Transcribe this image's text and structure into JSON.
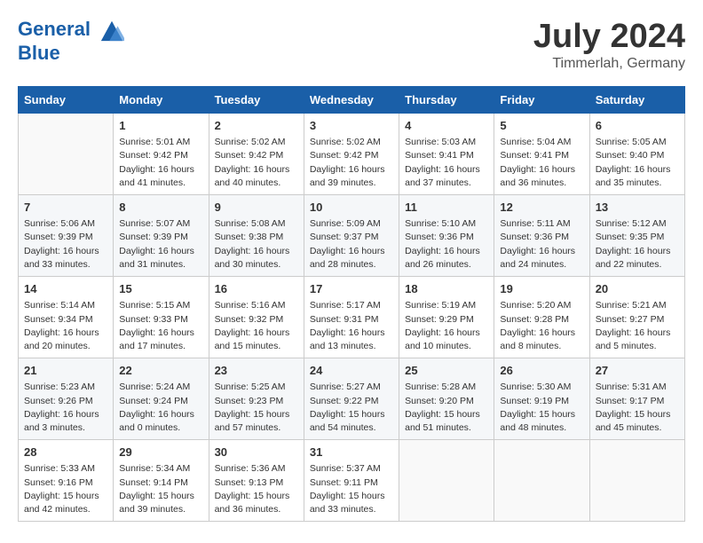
{
  "logo": {
    "line1": "General",
    "line2": "Blue"
  },
  "title": "July 2024",
  "subtitle": "Timmerlah, Germany",
  "days_header": [
    "Sunday",
    "Monday",
    "Tuesday",
    "Wednesday",
    "Thursday",
    "Friday",
    "Saturday"
  ],
  "weeks": [
    [
      {
        "day": "",
        "info": ""
      },
      {
        "day": "1",
        "info": "Sunrise: 5:01 AM\nSunset: 9:42 PM\nDaylight: 16 hours\nand 41 minutes."
      },
      {
        "day": "2",
        "info": "Sunrise: 5:02 AM\nSunset: 9:42 PM\nDaylight: 16 hours\nand 40 minutes."
      },
      {
        "day": "3",
        "info": "Sunrise: 5:02 AM\nSunset: 9:42 PM\nDaylight: 16 hours\nand 39 minutes."
      },
      {
        "day": "4",
        "info": "Sunrise: 5:03 AM\nSunset: 9:41 PM\nDaylight: 16 hours\nand 37 minutes."
      },
      {
        "day": "5",
        "info": "Sunrise: 5:04 AM\nSunset: 9:41 PM\nDaylight: 16 hours\nand 36 minutes."
      },
      {
        "day": "6",
        "info": "Sunrise: 5:05 AM\nSunset: 9:40 PM\nDaylight: 16 hours\nand 35 minutes."
      }
    ],
    [
      {
        "day": "7",
        "info": "Sunrise: 5:06 AM\nSunset: 9:39 PM\nDaylight: 16 hours\nand 33 minutes."
      },
      {
        "day": "8",
        "info": "Sunrise: 5:07 AM\nSunset: 9:39 PM\nDaylight: 16 hours\nand 31 minutes."
      },
      {
        "day": "9",
        "info": "Sunrise: 5:08 AM\nSunset: 9:38 PM\nDaylight: 16 hours\nand 30 minutes."
      },
      {
        "day": "10",
        "info": "Sunrise: 5:09 AM\nSunset: 9:37 PM\nDaylight: 16 hours\nand 28 minutes."
      },
      {
        "day": "11",
        "info": "Sunrise: 5:10 AM\nSunset: 9:36 PM\nDaylight: 16 hours\nand 26 minutes."
      },
      {
        "day": "12",
        "info": "Sunrise: 5:11 AM\nSunset: 9:36 PM\nDaylight: 16 hours\nand 24 minutes."
      },
      {
        "day": "13",
        "info": "Sunrise: 5:12 AM\nSunset: 9:35 PM\nDaylight: 16 hours\nand 22 minutes."
      }
    ],
    [
      {
        "day": "14",
        "info": "Sunrise: 5:14 AM\nSunset: 9:34 PM\nDaylight: 16 hours\nand 20 minutes."
      },
      {
        "day": "15",
        "info": "Sunrise: 5:15 AM\nSunset: 9:33 PM\nDaylight: 16 hours\nand 17 minutes."
      },
      {
        "day": "16",
        "info": "Sunrise: 5:16 AM\nSunset: 9:32 PM\nDaylight: 16 hours\nand 15 minutes."
      },
      {
        "day": "17",
        "info": "Sunrise: 5:17 AM\nSunset: 9:31 PM\nDaylight: 16 hours\nand 13 minutes."
      },
      {
        "day": "18",
        "info": "Sunrise: 5:19 AM\nSunset: 9:29 PM\nDaylight: 16 hours\nand 10 minutes."
      },
      {
        "day": "19",
        "info": "Sunrise: 5:20 AM\nSunset: 9:28 PM\nDaylight: 16 hours\nand 8 minutes."
      },
      {
        "day": "20",
        "info": "Sunrise: 5:21 AM\nSunset: 9:27 PM\nDaylight: 16 hours\nand 5 minutes."
      }
    ],
    [
      {
        "day": "21",
        "info": "Sunrise: 5:23 AM\nSunset: 9:26 PM\nDaylight: 16 hours\nand 3 minutes."
      },
      {
        "day": "22",
        "info": "Sunrise: 5:24 AM\nSunset: 9:24 PM\nDaylight: 16 hours\nand 0 minutes."
      },
      {
        "day": "23",
        "info": "Sunrise: 5:25 AM\nSunset: 9:23 PM\nDaylight: 15 hours\nand 57 minutes."
      },
      {
        "day": "24",
        "info": "Sunrise: 5:27 AM\nSunset: 9:22 PM\nDaylight: 15 hours\nand 54 minutes."
      },
      {
        "day": "25",
        "info": "Sunrise: 5:28 AM\nSunset: 9:20 PM\nDaylight: 15 hours\nand 51 minutes."
      },
      {
        "day": "26",
        "info": "Sunrise: 5:30 AM\nSunset: 9:19 PM\nDaylight: 15 hours\nand 48 minutes."
      },
      {
        "day": "27",
        "info": "Sunrise: 5:31 AM\nSunset: 9:17 PM\nDaylight: 15 hours\nand 45 minutes."
      }
    ],
    [
      {
        "day": "28",
        "info": "Sunrise: 5:33 AM\nSunset: 9:16 PM\nDaylight: 15 hours\nand 42 minutes."
      },
      {
        "day": "29",
        "info": "Sunrise: 5:34 AM\nSunset: 9:14 PM\nDaylight: 15 hours\nand 39 minutes."
      },
      {
        "day": "30",
        "info": "Sunrise: 5:36 AM\nSunset: 9:13 PM\nDaylight: 15 hours\nand 36 minutes."
      },
      {
        "day": "31",
        "info": "Sunrise: 5:37 AM\nSunset: 9:11 PM\nDaylight: 15 hours\nand 33 minutes."
      },
      {
        "day": "",
        "info": ""
      },
      {
        "day": "",
        "info": ""
      },
      {
        "day": "",
        "info": ""
      }
    ]
  ]
}
